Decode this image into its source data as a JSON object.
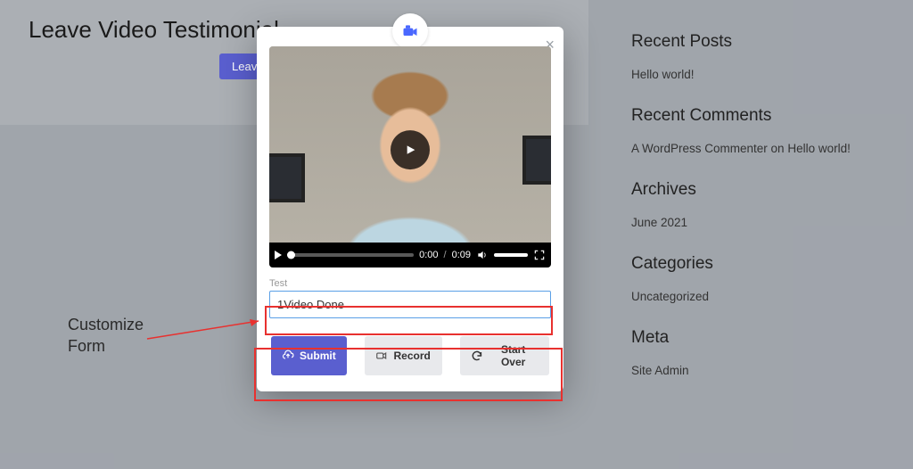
{
  "page": {
    "title": "Leave Video Testimonial",
    "leave_button": "Leave a"
  },
  "sidebar": {
    "recent_posts": {
      "heading": "Recent Posts",
      "items": [
        "Hello world!"
      ]
    },
    "recent_comments": {
      "heading": "Recent Comments",
      "items": [
        "A WordPress Commenter on Hello world!"
      ]
    },
    "archives": {
      "heading": "Archives",
      "items": [
        "June 2021"
      ]
    },
    "categories": {
      "heading": "Categories",
      "items": [
        "Uncategorized"
      ]
    },
    "meta": {
      "heading": "Meta",
      "items": [
        "Site Admin"
      ]
    }
  },
  "modal": {
    "video": {
      "time_current": "0:00",
      "time_total": "0:09"
    },
    "form": {
      "label": "Test",
      "value": "1Video Done"
    },
    "buttons": {
      "submit": "Submit",
      "record": "Record",
      "start_over": "Start Over"
    }
  },
  "annotation": {
    "label_line1": "Customize",
    "label_line2": "Form"
  }
}
